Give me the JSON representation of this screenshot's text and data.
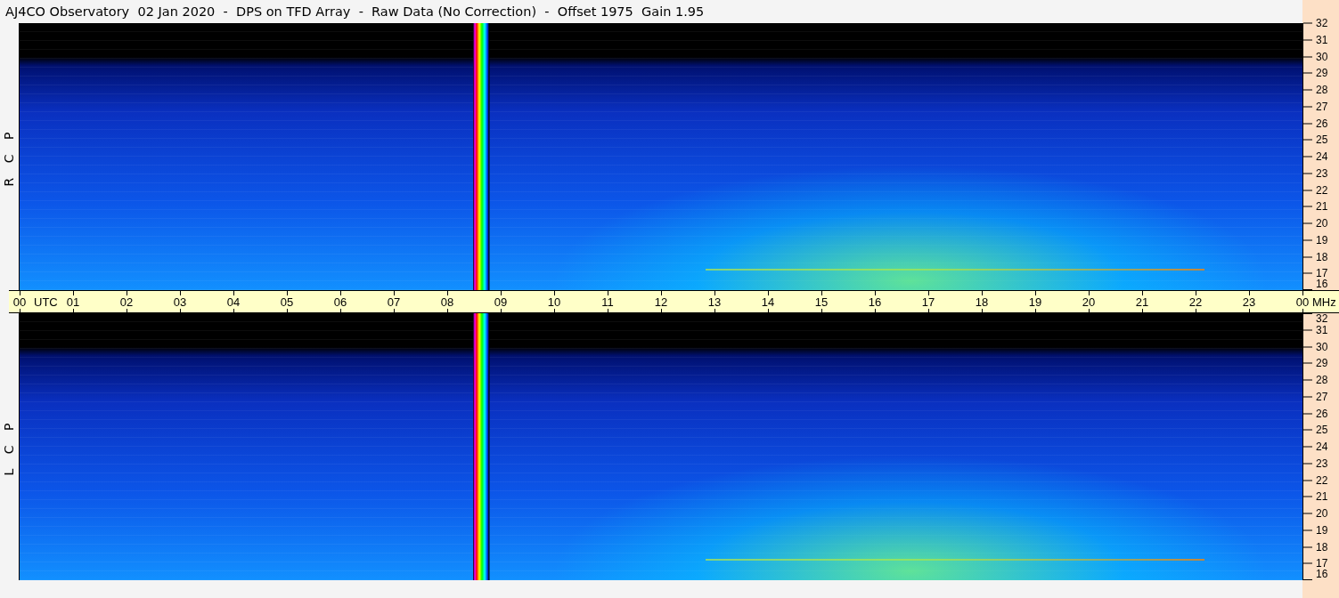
{
  "title": "AJ4CO Observatory  02 Jan 2020  -  DPS on TFD Array  -  Raw Data (No Correction)  -  Offset 1975  Gain 1.95",
  "panels": [
    {
      "label": "R C P",
      "freq_ticks": [
        "32",
        "31",
        "30",
        "29",
        "28",
        "27",
        "26",
        "25",
        "24",
        "23",
        "22",
        "21",
        "20",
        "19",
        "18",
        "17",
        "16"
      ]
    },
    {
      "label": "L C P",
      "freq_ticks": [
        "32",
        "31",
        "30",
        "29",
        "28",
        "27",
        "26",
        "25",
        "24",
        "23",
        "22",
        "21",
        "20",
        "19",
        "18",
        "17",
        "16"
      ]
    }
  ],
  "time_axis": {
    "ticks": [
      "00",
      "01",
      "02",
      "03",
      "04",
      "05",
      "06",
      "07",
      "08",
      "09",
      "10",
      "11",
      "12",
      "13",
      "14",
      "15",
      "16",
      "17",
      "18",
      "19",
      "20",
      "21",
      "22",
      "23",
      "00"
    ],
    "time_unit": "UTC",
    "freq_unit": "MHz"
  }
}
